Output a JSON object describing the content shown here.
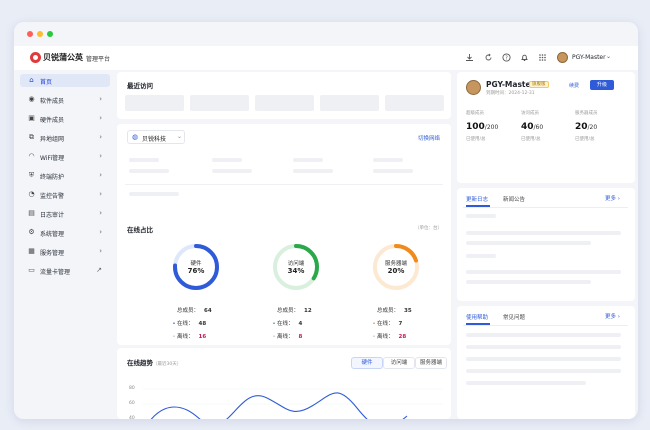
{
  "app": {
    "logo_text": "贝锐蒲公英",
    "subtitle": "管理平台",
    "user_name": "PGY-Master"
  },
  "icons": {
    "download": "download-icon",
    "refresh": "refresh-icon",
    "help": "help-icon",
    "bell": "bell-icon",
    "apps": "grid-icon"
  },
  "sidebar": {
    "items": [
      {
        "label": "首页",
        "icon": "home-icon",
        "active": true
      },
      {
        "label": "软件成员",
        "icon": "user-icon"
      },
      {
        "label": "硬件成员",
        "icon": "device-icon"
      },
      {
        "label": "异地组网",
        "icon": "network-icon"
      },
      {
        "label": "WiFi管理",
        "icon": "wifi-icon"
      },
      {
        "label": "终端防护",
        "icon": "shield-icon"
      },
      {
        "label": "监控告警",
        "icon": "alarm-icon"
      },
      {
        "label": "日志审计",
        "icon": "log-icon"
      },
      {
        "label": "系统管理",
        "icon": "settings-icon"
      },
      {
        "label": "服务管理",
        "icon": "service-icon"
      },
      {
        "label": "流量卡管理",
        "icon": "sim-icon"
      }
    ]
  },
  "recent": {
    "title": "最近访问"
  },
  "network": {
    "company": "贝锐科技",
    "switch_label": "切换网络"
  },
  "online": {
    "title": "在线占比",
    "unit": "（单位：台）",
    "groups": [
      {
        "name": "硬件",
        "percent": "76%",
        "ratio": 0.76,
        "color": "#2f5bd8",
        "track": "#dfe7fb",
        "total_label": "总成员：",
        "total": "64",
        "online_label": "在线：",
        "online": "48",
        "offline_label": "离线：",
        "offline": "16"
      },
      {
        "name": "访问端",
        "percent": "34%",
        "ratio": 0.34,
        "color": "#2aa84a",
        "track": "#d8f0dd",
        "total_label": "总成员：",
        "total": "12",
        "online_label": "在线：",
        "online": "4",
        "offline_label": "离线：",
        "offline": "8"
      },
      {
        "name": "服务器端",
        "percent": "20%",
        "ratio": 0.2,
        "color": "#f08a1c",
        "track": "#fde8d2",
        "total_label": "总成员：",
        "total": "35",
        "online_label": "在线：",
        "online": "7",
        "offline_label": "离线：",
        "offline": "28"
      }
    ]
  },
  "trend": {
    "title": "在线趋势",
    "subtitle": "（最近30天）",
    "tabs": [
      "硬件",
      "访问端",
      "服务器端"
    ],
    "y_ticks": [
      "80",
      "60",
      "40"
    ]
  },
  "profile": {
    "name": "PGY-Master",
    "badge": "旗舰版",
    "expire": "到期时间：2024-12-31",
    "renew_label": "续费",
    "upgrade_label": "升级",
    "quotas": [
      {
        "label": "超级成员",
        "used": "100",
        "total": "/200",
        "note": "已使用/总"
      },
      {
        "label": "访问成员",
        "used": "40",
        "total": "/60",
        "note": "已使用/总"
      },
      {
        "label": "服务器成员",
        "used": "20",
        "total": "/20",
        "note": "已使用/总"
      }
    ]
  },
  "news": {
    "tabs": [
      "更新日志",
      "新闻公告"
    ],
    "more": "更多"
  },
  "help": {
    "tabs": [
      "使用帮助",
      "常见问题"
    ],
    "more": "更多"
  }
}
